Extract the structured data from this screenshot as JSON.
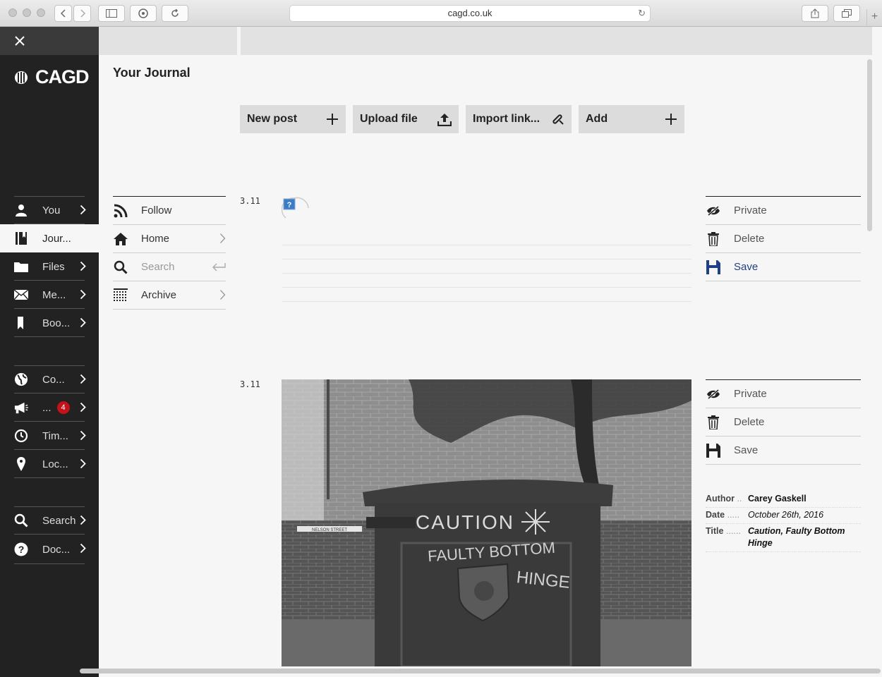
{
  "browser": {
    "url": "cagd.co.uk"
  },
  "brand": {
    "name": "CAGD"
  },
  "sidebar": {
    "group1": [
      {
        "label": "You",
        "icon": "person-icon"
      },
      {
        "label": "Jour...",
        "icon": "journal-icon",
        "active": true
      },
      {
        "label": "Files",
        "icon": "folder-icon"
      },
      {
        "label": "Me...",
        "icon": "envelope-icon"
      },
      {
        "label": "Boo...",
        "icon": "bookmark-icon"
      }
    ],
    "group2": [
      {
        "label": "Co...",
        "icon": "globe-icon"
      },
      {
        "label": "...",
        "icon": "megaphone-icon",
        "badge": "4"
      },
      {
        "label": "Tim...",
        "icon": "clock-icon"
      },
      {
        "label": "Loc...",
        "icon": "location-pin-icon"
      }
    ],
    "group3": [
      {
        "label": "Search",
        "icon": "search-icon"
      },
      {
        "label": "Doc...",
        "icon": "help-icon"
      }
    ]
  },
  "page": {
    "title": "Your Journal"
  },
  "actions": [
    {
      "label": "New post",
      "icon": "plus-icon"
    },
    {
      "label": "Upload file",
      "icon": "upload-icon"
    },
    {
      "label": "Import link...",
      "icon": "paperclip-icon"
    },
    {
      "label": "Add",
      "icon": "plus-icon"
    }
  ],
  "journal_menu": [
    {
      "label": "Follow",
      "icon": "rss-icon"
    },
    {
      "label": "Home",
      "icon": "home-icon"
    },
    {
      "label": "Search",
      "icon": "search-icon"
    },
    {
      "label": "Archive",
      "icon": "calendar-icon"
    }
  ],
  "posts": [
    {
      "date": "3.11",
      "actions": {
        "private": "Private",
        "delete": "Delete",
        "save": "Save"
      }
    },
    {
      "date": "3.11",
      "actions": {
        "private": "Private",
        "delete": "Delete",
        "save": "Save"
      },
      "photo_text": {
        "line1": "CAUTION",
        "line2": "FAULTY BOTTOM",
        "line3": "HINGE",
        "street_sign": "NELSON STREET"
      },
      "meta": {
        "author_label": "Author",
        "author": "Carey Gaskell",
        "date_label": "Date",
        "date": "October 26th, 2016",
        "title_label": "Title",
        "title_line1": "Caution, Faulty Bottom",
        "title_line2": "Hinge"
      }
    }
  ],
  "colors": {
    "sidebar_bg": "#222222",
    "badge": "#c3121a",
    "save_active": "#1f3f86"
  }
}
